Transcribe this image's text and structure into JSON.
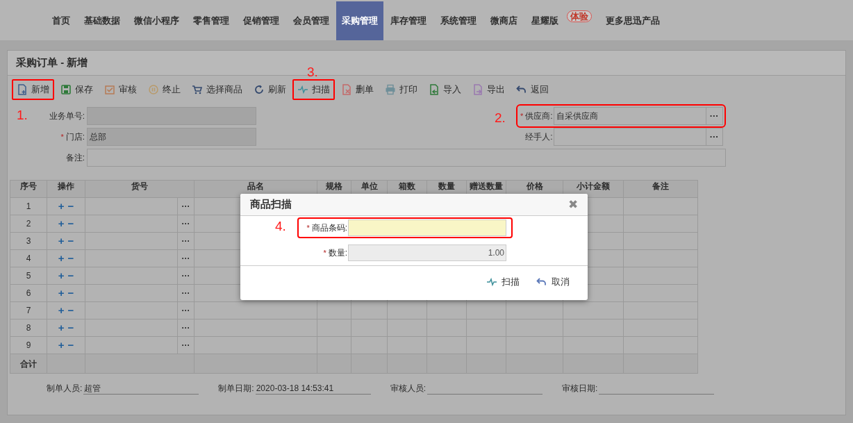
{
  "nav": [
    {
      "label": "首页",
      "selected": false
    },
    {
      "label": "基础数据",
      "selected": false
    },
    {
      "label": "微信小程序",
      "selected": false
    },
    {
      "label": "零售管理",
      "selected": false
    },
    {
      "label": "促销管理",
      "selected": false
    },
    {
      "label": "会员管理",
      "selected": false
    },
    {
      "label": "采购管理",
      "selected": true
    },
    {
      "label": "库存管理",
      "selected": false
    },
    {
      "label": "系统管理",
      "selected": false
    },
    {
      "label": "微商店",
      "selected": false
    },
    {
      "label": "星耀版",
      "selected": false,
      "badge": "体验"
    },
    {
      "label": "更多思迅产品",
      "selected": false
    }
  ],
  "panel": {
    "title": "采购订单 - 新增"
  },
  "toolbar": [
    {
      "label": "新增",
      "highlighted": true
    },
    {
      "label": "保存",
      "highlighted": false
    },
    {
      "label": "审核",
      "highlighted": false
    },
    {
      "label": "终止",
      "highlighted": false
    },
    {
      "label": "选择商品",
      "highlighted": false
    },
    {
      "label": "刷新",
      "highlighted": false
    },
    {
      "label": "扫描",
      "highlighted": true
    },
    {
      "label": "删单",
      "highlighted": false
    },
    {
      "label": "打印",
      "highlighted": false
    },
    {
      "label": "导入",
      "highlighted": false
    },
    {
      "label": "导出",
      "highlighted": false
    },
    {
      "label": "返回",
      "highlighted": false
    }
  ],
  "form_left": [
    {
      "label": "业务单号:",
      "required": false
    },
    {
      "label": "门店:",
      "required": true,
      "value": "总部"
    }
  ],
  "form_right": [
    {
      "label": "供应商:",
      "required": true,
      "value": "自采供应商",
      "picker": "···",
      "highlighted": true
    },
    {
      "label": "经手人:",
      "required": false,
      "picker": "···",
      "highlighted": false
    }
  ],
  "remark": {
    "label": "备注:"
  },
  "table": {
    "columns": [
      "序号",
      "操作",
      "货号",
      "品名",
      "规格",
      "单位",
      "箱数",
      "数量",
      "赠送数量",
      "价格",
      "小计金额",
      "备注"
    ],
    "rows": [
      {
        "no": "1",
        "add": "+",
        "remove": "−",
        "picker": "···"
      },
      {
        "no": "2",
        "add": "+",
        "remove": "−",
        "picker": "···"
      },
      {
        "no": "3",
        "add": "+",
        "remove": "−",
        "picker": "···"
      },
      {
        "no": "4",
        "add": "+",
        "remove": "−",
        "picker": "···"
      },
      {
        "no": "5",
        "add": "+",
        "remove": "−",
        "picker": "···"
      },
      {
        "no": "6",
        "add": "+",
        "remove": "−",
        "picker": "···"
      },
      {
        "no": "7",
        "add": "+",
        "remove": "−",
        "picker": "···"
      },
      {
        "no": "8",
        "add": "+",
        "remove": "−",
        "picker": "···"
      },
      {
        "no": "9",
        "add": "+",
        "remove": "−",
        "picker": "···"
      }
    ],
    "total_label": "合计"
  },
  "footer": [
    {
      "label": "制单人员:",
      "value": "超管"
    },
    {
      "label": "制单日期:",
      "value": "2020-03-18 14:53:41"
    },
    {
      "label": "审核人员:"
    },
    {
      "label": "审核日期:"
    }
  ],
  "dialog": {
    "title": "商品扫描",
    "close": "✖",
    "fields": [
      {
        "label": "商品条码:",
        "required": true,
        "highlighted": true,
        "kind": "input"
      },
      {
        "label": "数量:",
        "required": true,
        "highlighted": false,
        "kind": "readonly",
        "value": "1.00"
      }
    ],
    "buttons": [
      "扫描",
      "取消"
    ]
  },
  "annotations": [
    "1.",
    "2.",
    "3.",
    "4."
  ],
  "required_mark": "*"
}
